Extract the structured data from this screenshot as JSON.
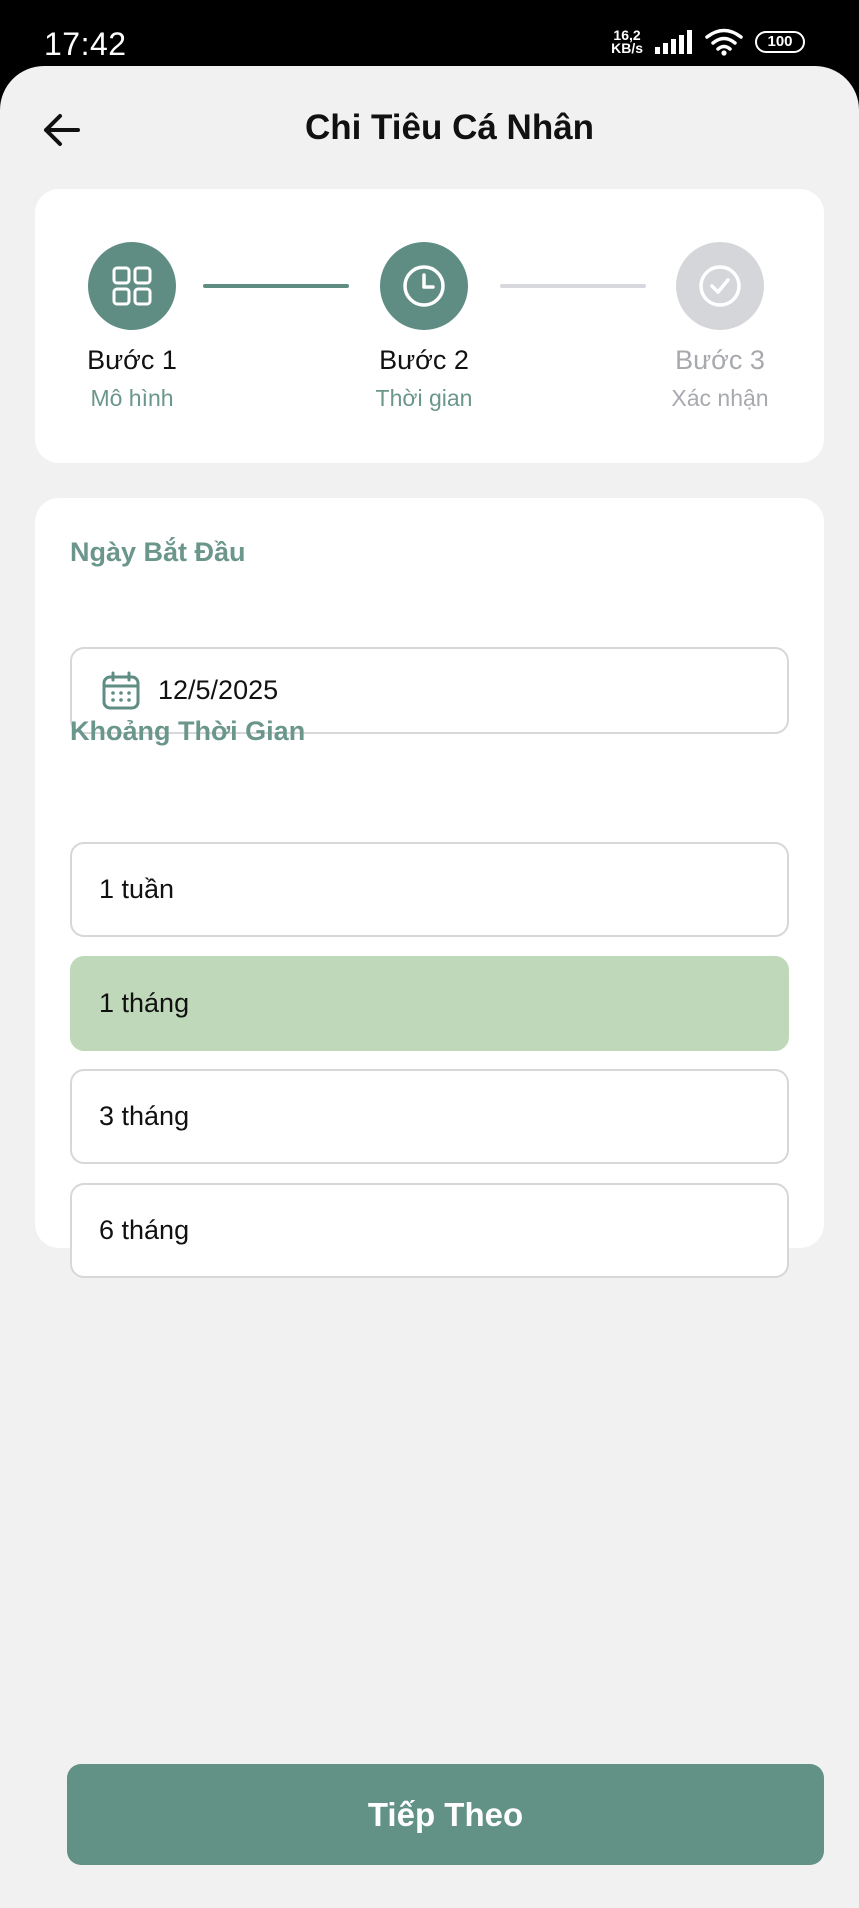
{
  "status_bar": {
    "time": "17:42",
    "net_speed_value": "16,2",
    "net_speed_unit": "KB/s",
    "battery": "100",
    "signal_icon": "signal-bars-icon",
    "wifi_icon": "wifi-icon"
  },
  "header": {
    "title": "Chi Tiêu Cá Nhân",
    "back_icon": "arrow-left-icon"
  },
  "stepper": {
    "steps": [
      {
        "title": "Bước 1",
        "subtitle": "Mô hình",
        "icon": "grid-icon",
        "state": "done"
      },
      {
        "title": "Bước 2",
        "subtitle": "Thời gian",
        "icon": "clock-icon",
        "state": "current"
      },
      {
        "title": "Bước 3",
        "subtitle": "Xác nhận",
        "icon": "check-circle-icon",
        "state": "todo"
      }
    ]
  },
  "form": {
    "start_date_label": "Ngày Bắt Đầu",
    "start_date_value": "12/5/2025",
    "period_label": "Khoảng Thời Gian",
    "period_options": [
      "1 tuần",
      "1 tháng",
      "3 tháng",
      "6 tháng"
    ],
    "selected_period": "1 tháng"
  },
  "footer": {
    "next_label": "Tiếp Theo"
  },
  "colors": {
    "accent": "#5f8d83",
    "accent_label": "#6a968c",
    "selected_bg": "#bfd8b9",
    "inactive": "#d4d6da",
    "background": "#f1f1f2"
  }
}
